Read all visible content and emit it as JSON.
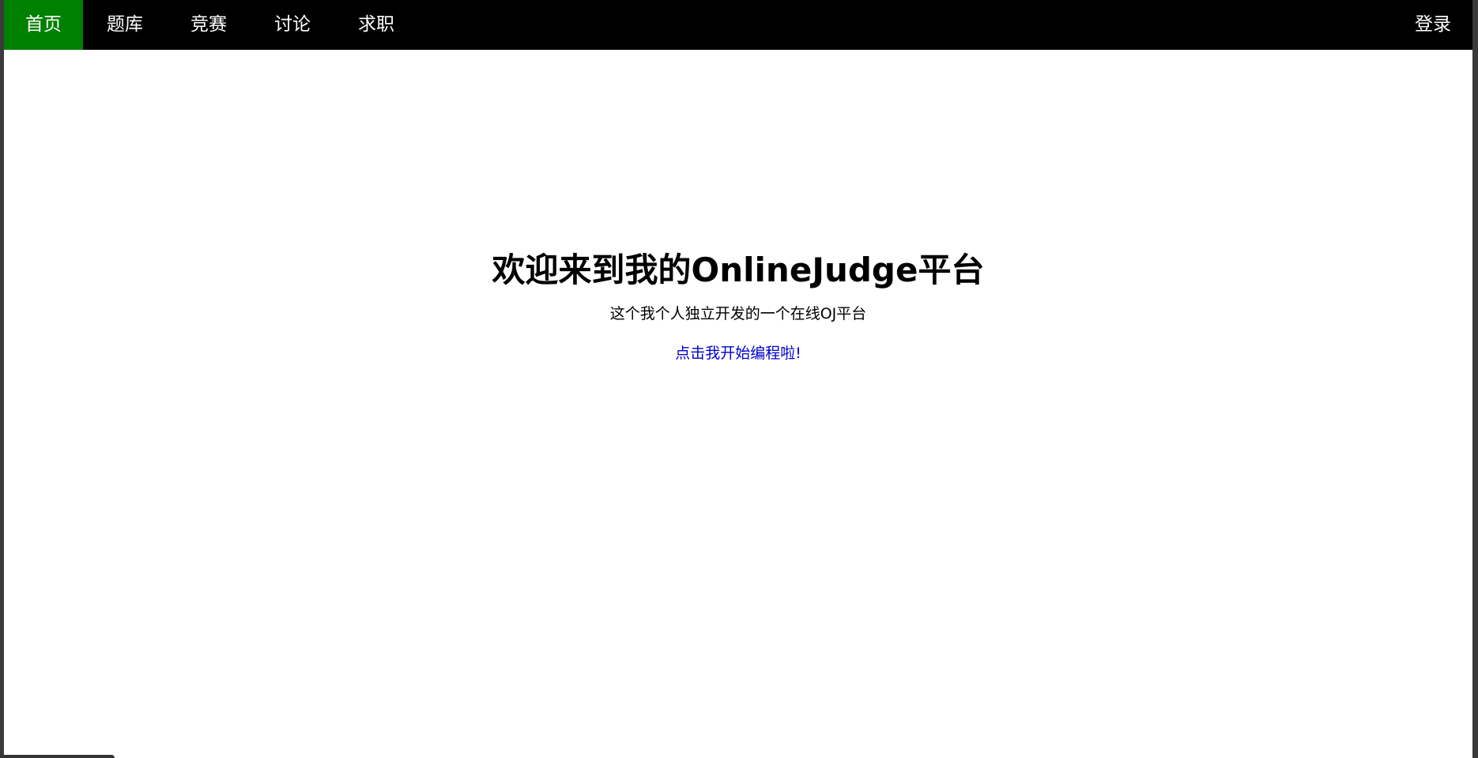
{
  "nav": {
    "items": [
      {
        "label": "首页",
        "active": true
      },
      {
        "label": "题库"
      },
      {
        "label": "竞赛"
      },
      {
        "label": "讨论"
      },
      {
        "label": "求职"
      }
    ],
    "login_label": "登录"
  },
  "hero": {
    "title": "欢迎来到我的OnlineJudge平台",
    "subtitle": "这个我个人独立开发的一个在线OJ平台",
    "cta_label": "点击我开始编程啦!"
  },
  "colors": {
    "navbar_bg": "#000000",
    "active_nav_bg": "#008000",
    "link": "#0000cc"
  }
}
